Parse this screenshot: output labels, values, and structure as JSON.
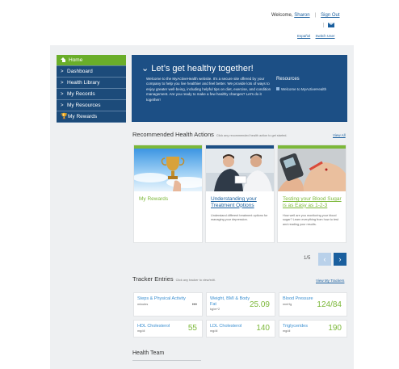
{
  "header": {
    "welcome_prefix": "Welcome, ",
    "user_name": "Sharon",
    "signout": "Sign Out",
    "pipe": "|",
    "lang": "Español",
    "switch_user": "Switch User",
    "mail_icon": "envelope-icon"
  },
  "sidebar": {
    "items": [
      {
        "label": "Home",
        "icon": "home-icon",
        "active": true
      },
      {
        "label": "Dashboard"
      },
      {
        "label": "Health Library"
      },
      {
        "label": "My Records"
      },
      {
        "label": "My Resources"
      },
      {
        "label": "My Rewards",
        "icon": "trophy-icon"
      }
    ],
    "chevron": ">",
    "trophy_glyph": "🏆"
  },
  "hero": {
    "title": "Let’s get healthy together!",
    "chevron": "⌄",
    "body": "Welcome to the MyActiveHealth website. It’s a secure site offered by your company to help you live healthier and feel better. We provide lots of ways to enjoy greater well-being, including helpful tips on diet, exercise, and condition management. Are you ready to make a few healthy changes? Let’s do it together!",
    "resources_title": "Resources",
    "resources_link": "Welcome to MyActiveHealth"
  },
  "recommended": {
    "title": "Recommended Health Actions",
    "subtitle": "Click any recommended health action to get started.",
    "view_all": "View All",
    "cards": [
      {
        "title": "My Rewards",
        "desc": ""
      },
      {
        "title": "Understanding your Treatment Options",
        "desc": "Understand different treatment options for managing your depression."
      },
      {
        "title": "Testing your Blood Sugar is as Easy as 1-2-3",
        "desc": "How well are you monitoring your blood sugar? Learn everything from how to test and reading your results."
      }
    ],
    "pager": "1/5",
    "prev": "‹",
    "next": "›"
  },
  "tracker": {
    "title": "Tracker Entries",
    "subtitle": "Click any tracker to view/edit.",
    "view_link": "View My Trackers",
    "tiles": [
      {
        "name": "Steps & Physical Activity",
        "unit": "minutes",
        "value": "",
        "more": "•••"
      },
      {
        "name": "Weight, BMI & Body Fat",
        "unit": "kg/m^2",
        "value": "25.09"
      },
      {
        "name": "Blood Pressure",
        "unit": "mmHg",
        "value": "124/84"
      },
      {
        "name": "HDL Cholesterol",
        "unit": "mg/dl",
        "value": "55"
      },
      {
        "name": "LDL Cholesterol",
        "unit": "mg/dl",
        "value": "140"
      },
      {
        "name": "Triglycerides",
        "unit": "mg/dl",
        "value": "190"
      }
    ]
  },
  "team": {
    "title": "Health Team"
  },
  "colors": {
    "navy": "#1c4b7a",
    "green": "#6aae2a",
    "hero": "#1c4f85",
    "link": "#1a5f9e",
    "pager_inactive": "#b9d1ea",
    "pager_active": "#1a5f9e"
  }
}
